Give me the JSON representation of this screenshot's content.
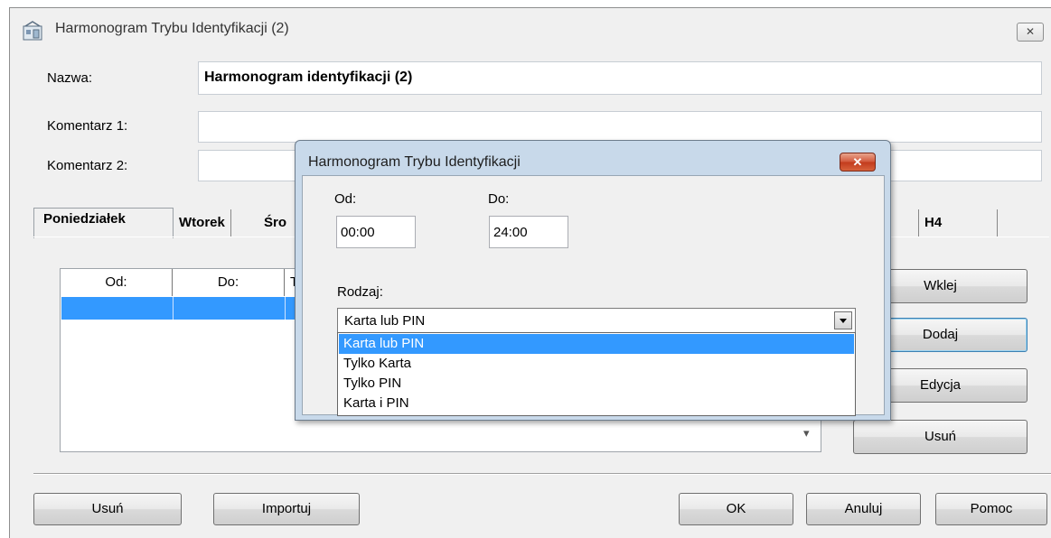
{
  "window": {
    "title": "Harmonogram Trybu Identyfikacji (2)",
    "close_label": "✕"
  },
  "form": {
    "name_label": "Nazwa:",
    "name_value": "Harmonogram identyfikacji (2)",
    "comment1_label": "Komentarz 1:",
    "comment1_value": "",
    "comment2_label": "Komentarz 2:",
    "comment2_value": ""
  },
  "tabs": [
    {
      "label": "Poniedziałek"
    },
    {
      "label": "Wtorek"
    },
    {
      "label": "Śro"
    },
    {
      "label": "H4"
    }
  ],
  "grid": {
    "columns": [
      "Od:",
      "Do:",
      "T"
    ],
    "scroll_arrow": "▾"
  },
  "side_buttons": {
    "paste": "Wklej",
    "add": "Dodaj",
    "edit": "Edycja",
    "delete": "Usuń"
  },
  "bottom_buttons": {
    "delete": "Usuń",
    "import": "Importuj",
    "ok": "OK",
    "cancel": "Anuluj",
    "help": "Pomoc"
  },
  "dialog": {
    "title": "Harmonogram Trybu Identyfikacji",
    "close_label": "✕",
    "from_label": "Od:",
    "from_value": "00:00",
    "to_label": "Do:",
    "to_value": "24:00",
    "type_label": "Rodzaj:",
    "type_value": "Karta lub PIN",
    "type_options": [
      "Karta lub PIN",
      "Tylko Karta",
      "Tylko PIN",
      "Karta i PIN"
    ]
  },
  "colors": {
    "selection": "#3399ff",
    "dialog_frame": "#c8d9ea",
    "close_red": "#c23a1c"
  }
}
